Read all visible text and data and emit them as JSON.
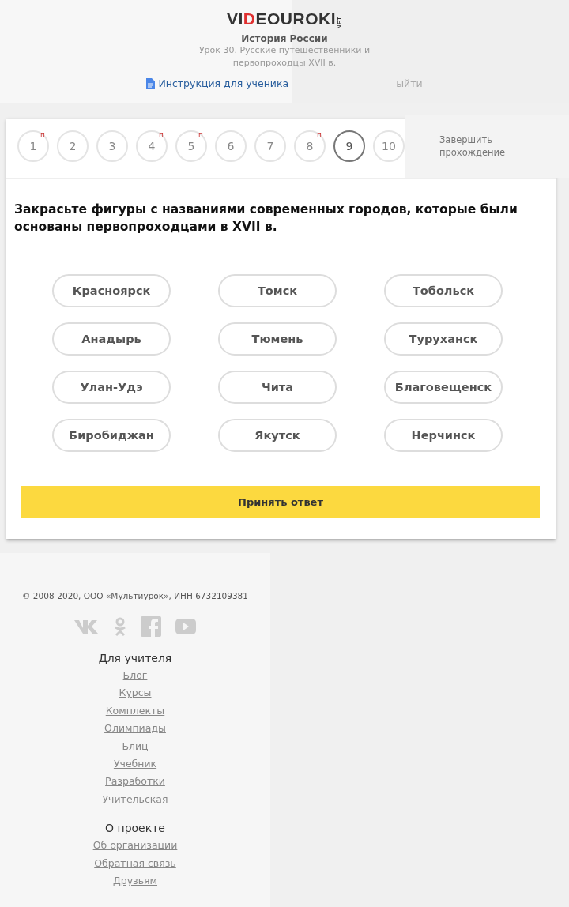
{
  "header": {
    "logo": {
      "before": "VI",
      "accent": "D",
      "after": "EOUROKI",
      "suffix": "NET"
    },
    "subject": "История России",
    "lesson": "Урок 30. Русские путешественники и первопроходцы XVII в.",
    "instruction_link": "Инструкция для ученика",
    "exit_link": "ыйти"
  },
  "question_nav": {
    "items": [
      {
        "label": "1",
        "mark": "п",
        "selected": false
      },
      {
        "label": "2",
        "selected": false
      },
      {
        "label": "3",
        "selected": false
      },
      {
        "label": "4",
        "mark": "п",
        "selected": false
      },
      {
        "label": "5",
        "mark": "п",
        "selected": false
      },
      {
        "label": "6",
        "selected": false
      },
      {
        "label": "7",
        "selected": false
      },
      {
        "label": "8",
        "mark": "п",
        "selected": false
      },
      {
        "label": "9",
        "selected": true
      },
      {
        "label": "10",
        "selected": false
      }
    ],
    "finish": "Завершить прохождение"
  },
  "question": "Закрасьте фигуры с названиями современных городов, которые были основаны первопроходцами в XVII в.",
  "options": [
    {
      "label": "Красноярск",
      "selected": false
    },
    {
      "label": "Томск",
      "selected": false
    },
    {
      "label": "Тобольск",
      "selected": false
    },
    {
      "label": "Анадырь",
      "selected": false
    },
    {
      "label": "Тюмень",
      "selected": false
    },
    {
      "label": "Туруханск",
      "selected": false
    },
    {
      "label": "Улан-Удэ",
      "selected": false
    },
    {
      "label": "Чита",
      "selected": false
    },
    {
      "label": "Благовещенск",
      "selected": false
    },
    {
      "label": "Биробиджан",
      "selected": false
    },
    {
      "label": "Якутск",
      "selected": false
    },
    {
      "label": "Нерчинск",
      "selected": false
    }
  ],
  "submit_button": "Принять ответ",
  "footer": {
    "copyright": "© 2008-2020, ООО «Мультиурок», ИНН 6732109381",
    "sections": [
      {
        "title": "Для учителя",
        "links": [
          "Блог",
          "Курсы",
          "Комплекты",
          "Олимпиады",
          "Блиц",
          "Учебник",
          "Разработки",
          "Учительская"
        ]
      },
      {
        "title": "О проекте",
        "links": [
          "Об организации",
          "Обратная связь",
          "Друзьям"
        ]
      }
    ]
  }
}
